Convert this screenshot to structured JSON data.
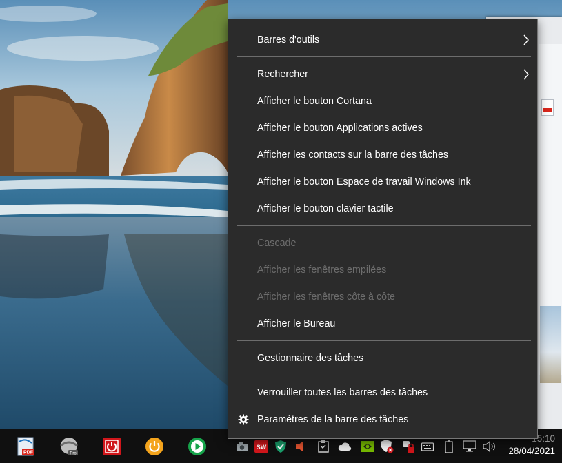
{
  "context_menu": {
    "items": [
      {
        "label": "Barres d'outils",
        "has_submenu": true,
        "enabled": true
      },
      {
        "label": "Rechercher",
        "has_submenu": true,
        "enabled": true
      },
      {
        "label": "Afficher le bouton Cortana",
        "enabled": true
      },
      {
        "label": "Afficher le bouton Applications actives",
        "enabled": true
      },
      {
        "label": "Afficher les contacts sur la barre des tâches",
        "enabled": true
      },
      {
        "label": "Afficher le bouton Espace de travail Windows Ink",
        "enabled": true
      },
      {
        "label": "Afficher le bouton clavier tactile",
        "enabled": true
      },
      {
        "label": "Cascade",
        "enabled": false
      },
      {
        "label": "Afficher les fenêtres empilées",
        "enabled": false
      },
      {
        "label": "Afficher les fenêtres côte à côte",
        "enabled": false
      },
      {
        "label": "Afficher le Bureau",
        "enabled": true
      },
      {
        "label": "Gestionnaire des tâches",
        "enabled": true
      },
      {
        "label": "Verrouiller toutes les barres des tâches",
        "enabled": true
      },
      {
        "label": "Paramètres de la barre des tâches",
        "icon": "gear-icon",
        "enabled": true
      }
    ]
  },
  "taskbar": {
    "pinned_apps": [
      {
        "icon": "pdf-app-icon",
        "accent": "#1e73be"
      },
      {
        "icon": "pro-disc-app-icon",
        "accent": "#c0c0c0"
      },
      {
        "icon": "red-power-app-icon",
        "accent": "#d0161b"
      },
      {
        "icon": "orange-power-app-icon",
        "accent": "#f4a41c"
      },
      {
        "icon": "green-play-app-icon",
        "accent": "#16a34a"
      }
    ],
    "tray_icons": [
      "camera-tray-icon",
      "sw-tray-icon",
      "shield-check-tray-icon",
      "speaker-red-tray-icon",
      "clipboard-tray-icon",
      "cloud-tray-icon",
      "nvidia-tray-icon",
      "security-shield-tray-icon",
      "lock-tray-icon",
      "keyboard-tray-icon",
      "battery-tray-icon",
      "network-tray-icon",
      "volume-tray-icon"
    ],
    "clock": {
      "time": "15:10",
      "date": "28/04/2021"
    }
  },
  "colors": {
    "menu_bg": "#2b2b2b",
    "menu_text": "#ffffff",
    "menu_disabled": "#6d6d6d",
    "taskbar_bg": "#101010"
  }
}
